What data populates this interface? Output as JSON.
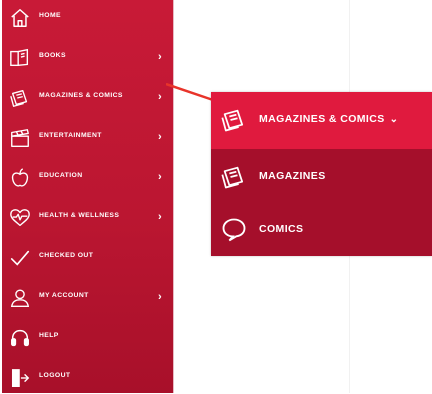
{
  "sidebar": {
    "items": [
      {
        "label": "HOME",
        "icon": "home-icon",
        "has_submenu": false
      },
      {
        "label": "BOOKS",
        "icon": "books-icon",
        "has_submenu": true
      },
      {
        "label": "MAGAZINES & COMICS",
        "icon": "magazines-comics-icon",
        "has_submenu": true
      },
      {
        "label": "ENTERTAINMENT",
        "icon": "clapperboard-icon",
        "has_submenu": true
      },
      {
        "label": "EDUCATION",
        "icon": "apple-icon",
        "has_submenu": true
      },
      {
        "label": "HEALTH & WELLNESS",
        "icon": "heart-pulse-icon",
        "has_submenu": true
      },
      {
        "label": "CHECKED OUT",
        "icon": "checkmark-icon",
        "has_submenu": false
      },
      {
        "label": "MY ACCOUNT",
        "icon": "user-icon",
        "has_submenu": true
      },
      {
        "label": "HELP",
        "icon": "headset-icon",
        "has_submenu": false
      },
      {
        "label": "LOGOUT",
        "icon": "logout-door-icon",
        "has_submenu": false
      }
    ],
    "chevron": "›"
  },
  "popout": {
    "header_label": "MAGAZINES & COMICS",
    "header_chevron": "⌄",
    "items": [
      {
        "label": "MAGAZINES",
        "icon": "magazine-icon"
      },
      {
        "label": "COMICS",
        "icon": "speech-bubble-icon"
      }
    ]
  },
  "colors": {
    "sidebar_bg": "#bb1631",
    "popout_header_bg": "#e01a3e",
    "popout_bg": "#a50f2b",
    "connector_line": "#e8342a",
    "text": "#ffffff"
  }
}
